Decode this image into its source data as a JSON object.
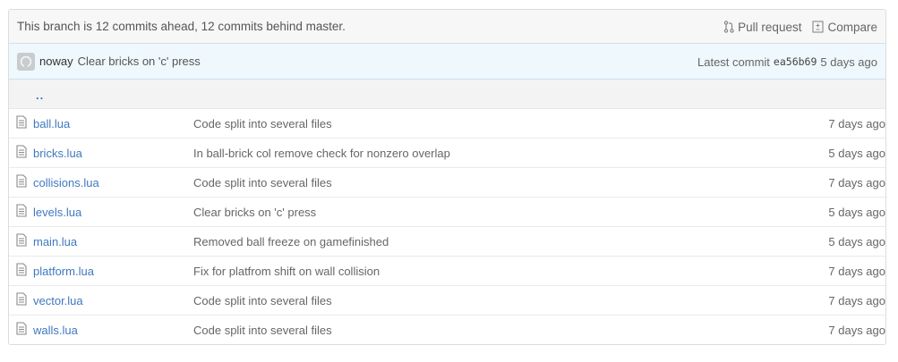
{
  "branch": {
    "status": "This branch is 12 commits ahead, 12 commits behind master.",
    "pull_request_label": "Pull request",
    "compare_label": "Compare"
  },
  "latest_commit": {
    "author": "noway",
    "message": "Clear bricks on 'c' press",
    "label": "Latest commit",
    "sha": "ea56b69",
    "age": "5 days ago"
  },
  "parent_link": "..",
  "files": [
    {
      "name": "ball.lua",
      "message": "Code split into several files",
      "age": "7 days ago"
    },
    {
      "name": "bricks.lua",
      "message": "In ball-brick col remove check for nonzero overlap",
      "age": "5 days ago"
    },
    {
      "name": "collisions.lua",
      "message": "Code split into several files",
      "age": "7 days ago"
    },
    {
      "name": "levels.lua",
      "message": "Clear bricks on 'c' press",
      "age": "5 days ago"
    },
    {
      "name": "main.lua",
      "message": "Removed ball freeze on gamefinished",
      "age": "5 days ago"
    },
    {
      "name": "platform.lua",
      "message": "Fix for platfrom shift on wall collision",
      "age": "7 days ago"
    },
    {
      "name": "vector.lua",
      "message": "Code split into several files",
      "age": "7 days ago"
    },
    {
      "name": "walls.lua",
      "message": "Code split into several files",
      "age": "7 days ago"
    }
  ],
  "colors": {
    "link": "#4078c0",
    "commit_bar_bg": "#eef8fd",
    "branch_bar_bg": "#f7f7f7"
  }
}
